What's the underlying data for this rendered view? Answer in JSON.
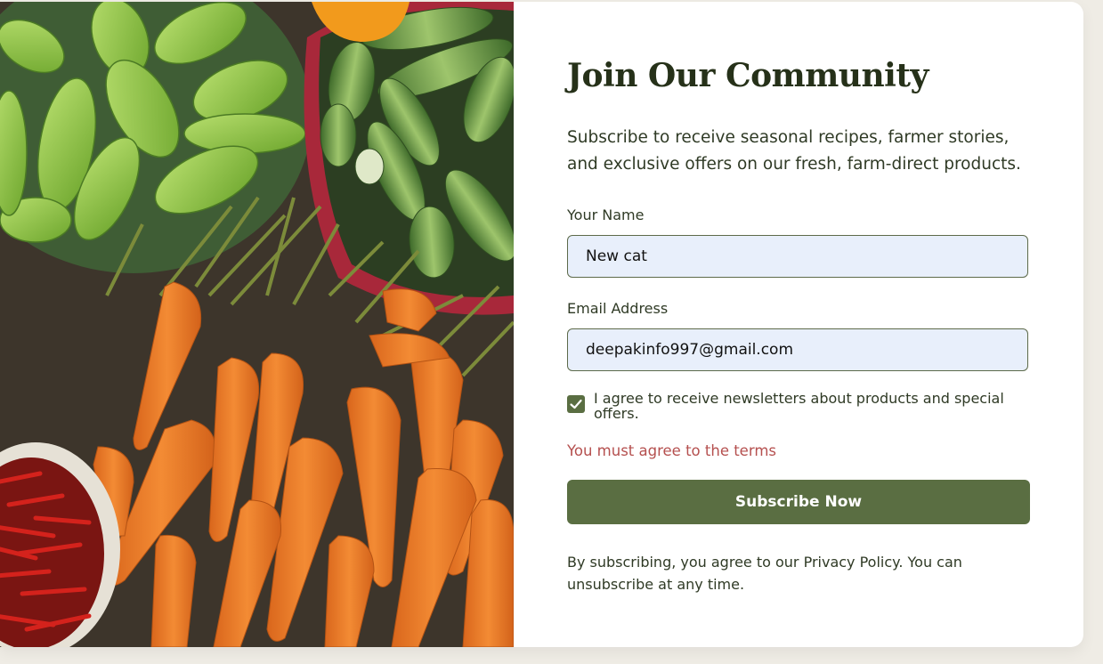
{
  "signup": {
    "image_alt": "Fresh vegetables",
    "title": "Join Our Community",
    "intro": "Subscribe to receive seasonal recipes, farmer stories, and exclusive offers on our fresh, farm-direct products.",
    "name_label": "Your Name",
    "name_value": "New cat",
    "email_label": "Email Address",
    "email_value": "deepakinfo997@gmail.com",
    "consent_checked": true,
    "consent_label": "I agree to receive newsletters about products and special offers.",
    "error_text": "You must agree to the terms",
    "submit_label": "Subscribe Now",
    "footnote": "By subscribing, you agree to our Privacy Policy. You can unsubscribe at any time."
  },
  "colors": {
    "accent": "#5a6e42",
    "title": "#263119",
    "error": "#b5504f",
    "input_bg": "#e8effb",
    "page_bg": "#efece5"
  },
  "icons": {
    "checkbox": "check-icon"
  }
}
